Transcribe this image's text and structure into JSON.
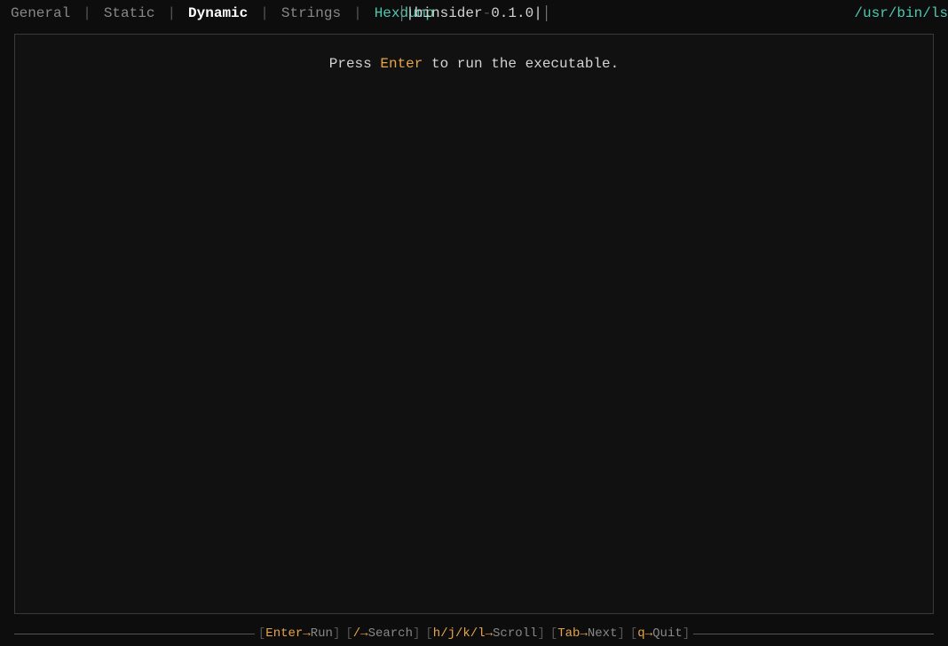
{
  "header": {
    "title": {
      "pipe_left": "|",
      "app_name": "binsider",
      "separator": "-",
      "version": "0.1.0",
      "pipe_right": "|"
    },
    "tabs": [
      {
        "id": "general",
        "label": "General",
        "active": false
      },
      {
        "id": "static",
        "label": "Static",
        "active": false
      },
      {
        "id": "dynamic",
        "label": "Dynamic",
        "active": true
      },
      {
        "id": "strings",
        "label": "Strings",
        "active": false
      },
      {
        "id": "hexdump",
        "label": "Hexdump",
        "active": false,
        "teal": true
      }
    ],
    "file_path": "/usr/bin/ls"
  },
  "main": {
    "prompt": {
      "press": "Press",
      "enter_key": "Enter",
      "rest": "to run the executable."
    }
  },
  "footer": {
    "shortcuts": [
      {
        "key": "Enter",
        "arrow": "→",
        "action": "Run"
      },
      {
        "key": "/",
        "arrow": "→",
        "action": "Search"
      },
      {
        "key": "h/j/k/l",
        "arrow": "→",
        "action": "Scroll"
      },
      {
        "key": "Tab",
        "arrow": "→",
        "action": "Next"
      },
      {
        "key": "q",
        "arrow": "→",
        "action": "Quit"
      }
    ]
  }
}
